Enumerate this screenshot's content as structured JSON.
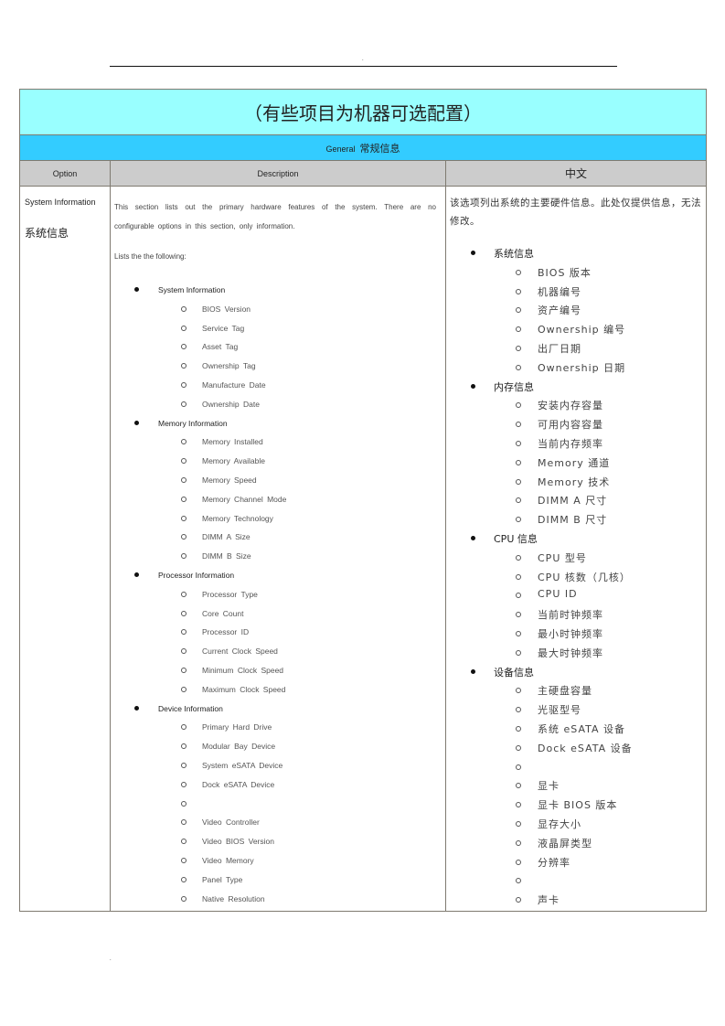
{
  "page": {
    "top_marker": ".",
    "bottom_marker": "."
  },
  "table": {
    "title": "（有些项目为机器可选配置）",
    "section": {
      "en": "General",
      "zh": "常规信息"
    },
    "headers": {
      "option": "Option",
      "description": "Description",
      "chinese": "中文"
    },
    "colors": {
      "title_bg": "#99ffff",
      "section_bg": "#33ccff",
      "header_bg": "#cccccc",
      "border": "#7f7a70"
    },
    "row": {
      "option_en": "System Information",
      "option_zh": "系统信息",
      "description_intro": "This section lists out the primary hardware features of the system. There are no configurable options in this section, only information.",
      "description_lists": "Lists the the following:",
      "chinese_intro": "该选项列出系统的主要硬件信息。此处仅提供信息，无法修改。",
      "description_groups": [
        {
          "title": "System Information",
          "items": [
            "BIOS Version",
            "Service Tag",
            "Asset Tag",
            "Ownership Tag",
            "Manufacture Date",
            "Ownership Date"
          ]
        },
        {
          "title": "Memory Information",
          "items": [
            "Memory Installed",
            "Memory Available",
            "Memory Speed",
            "Memory Channel Mode",
            "Memory Technology",
            "DIMM A Size",
            "DIMM B Size"
          ]
        },
        {
          "title": "Processor Information",
          "items": [
            "Processor Type",
            "Core Count",
            "Processor ID",
            "Current Clock Speed",
            "Minimum Clock Speed",
            "Maximum Clock Speed"
          ]
        },
        {
          "title": "Device Information",
          "items": [
            "Primary Hard Drive",
            "Modular Bay Device",
            "System eSATA Device",
            "Dock eSATA Device",
            "",
            "Video Controller",
            "Video BIOS Version",
            "Video Memory",
            "Panel Type",
            "Native Resolution"
          ]
        }
      ],
      "chinese_groups": [
        {
          "title": "系统信息",
          "items": [
            "BIOS 版本",
            "机器编号",
            "资产编号",
            "Ownership 编号",
            "出厂日期",
            "Ownership 日期"
          ]
        },
        {
          "title": "内存信息",
          "items": [
            "安装内存容量",
            "可用内容容量",
            "当前内存频率",
            "Memory 通道",
            "Memory 技术",
            "DIMM A 尺寸",
            "DIMM B 尺寸"
          ]
        },
        {
          "title": "CPU 信息",
          "items": [
            "CPU 型号",
            "CPU 核数（几核）",
            "CPU ID",
            "当前时钟频率",
            "最小时钟频率",
            "最大时钟频率"
          ]
        },
        {
          "title": "设备信息",
          "items": [
            "主硬盘容量",
            "光驱型号",
            "系统 eSATA 设备",
            "Dock eSATA 设备",
            "",
            "显卡",
            "显卡 BIOS 版本",
            "显存大小",
            "液晶屏类型",
            "分辨率",
            "",
            "声卡"
          ]
        }
      ]
    }
  }
}
